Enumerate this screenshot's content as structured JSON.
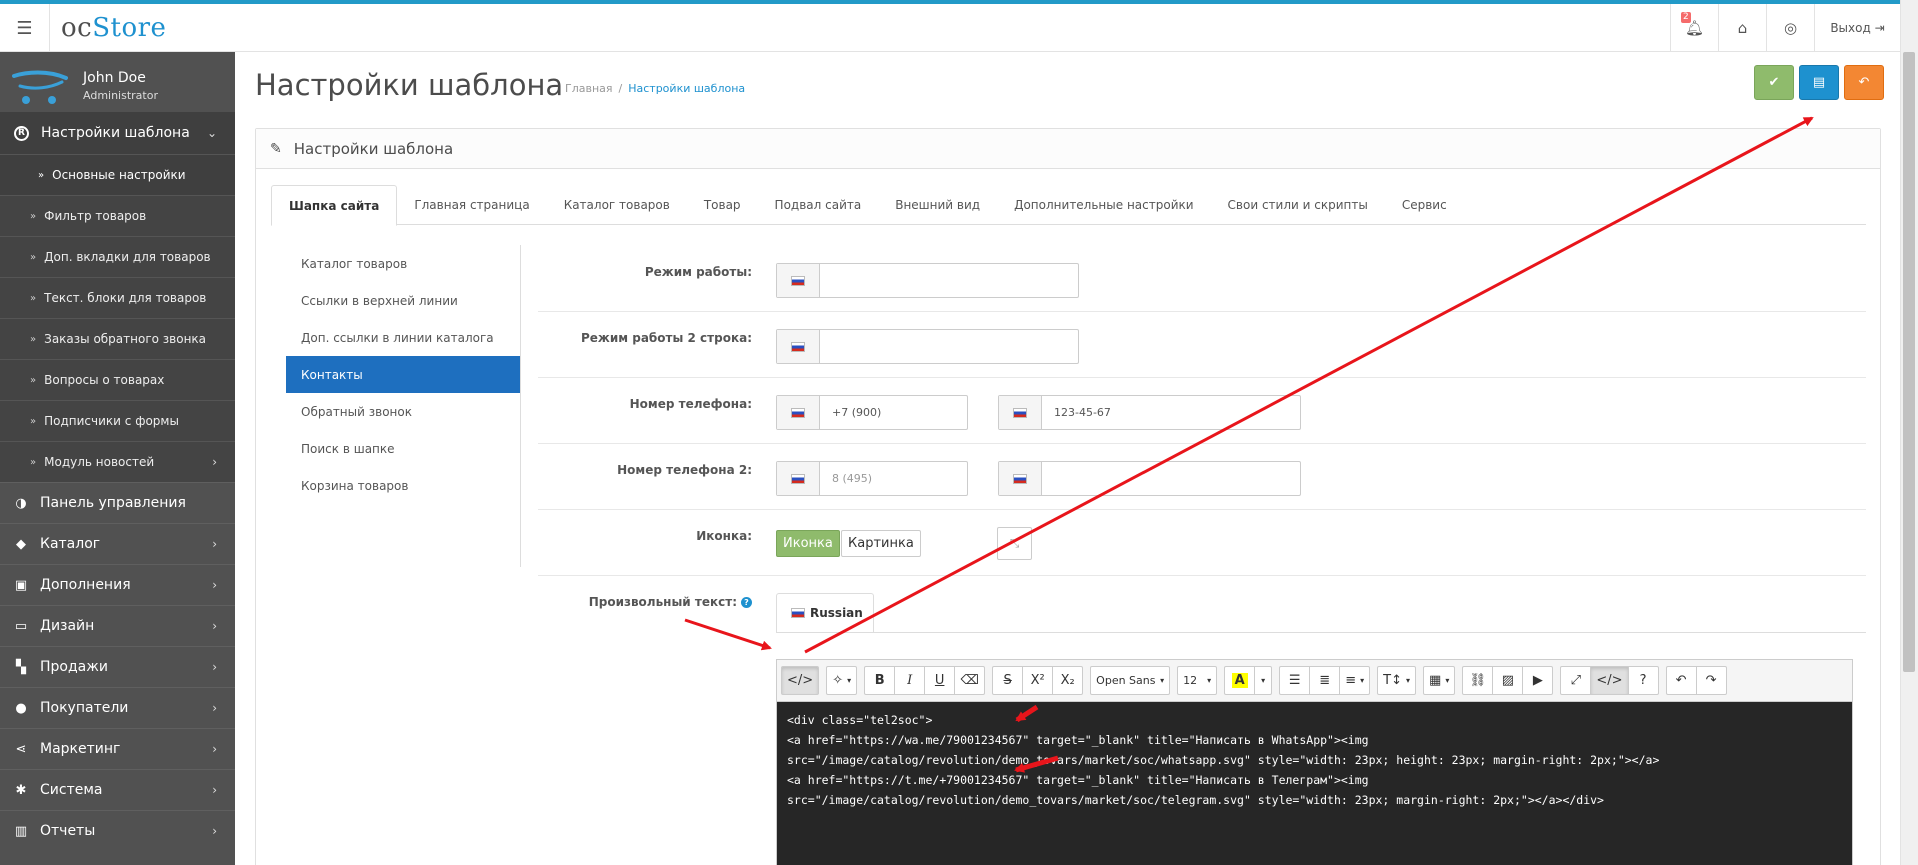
{
  "header": {
    "brand_oc": "oc",
    "brand_store": "Store",
    "notifications_count": "2",
    "logout_label": "Выход"
  },
  "sidebar": {
    "user_name": "John Doe",
    "user_role": "Administrator",
    "active_section": "Настройки шаблона",
    "active_sub": "Основные настройки",
    "sub_items": [
      "Фильтр товаров",
      "Доп. вкладки для товаров",
      "Текст. блоки для товаров",
      "Заказы обратного звонка",
      "Вопросы о товарах",
      "Подписчики с формы",
      "Модуль новостей"
    ],
    "main_items": [
      {
        "label": "Панель управления",
        "icon": "dashboard-icon"
      },
      {
        "label": "Каталог",
        "icon": "tag-icon"
      },
      {
        "label": "Дополнения",
        "icon": "puzzle-icon"
      },
      {
        "label": "Дизайн",
        "icon": "monitor-icon"
      },
      {
        "label": "Продажи",
        "icon": "cart-icon"
      },
      {
        "label": "Покупатели",
        "icon": "user-icon"
      },
      {
        "label": "Маркетинг",
        "icon": "share-icon"
      },
      {
        "label": "Система",
        "icon": "gear-icon"
      },
      {
        "label": "Отчеты",
        "icon": "bar-chart-icon"
      }
    ]
  },
  "page": {
    "title": "Настройки шаблона",
    "breadcrumb_home": "Главная",
    "breadcrumb_current": "Настройки шаблона",
    "panel_title": "Настройки шаблона"
  },
  "tabs": [
    "Шапка сайта",
    "Главная страница",
    "Каталог товаров",
    "Товар",
    "Подвал сайта",
    "Внешний вид",
    "Дополнительные настройки",
    "Свои стили и скрипты",
    "Сервис"
  ],
  "vnav": [
    "Каталог товаров",
    "Ссылки в верхней линии",
    "Доп. ссылки в линии каталога",
    "Контакты",
    "Обратный звонок",
    "Поиск в шапке",
    "Корзина товаров"
  ],
  "form": {
    "work_mode_label": "Режим работы:",
    "work_mode_value": "",
    "work_mode2_label": "Режим работы 2 строка:",
    "work_mode2_value": "",
    "phone_label": "Номер телефона:",
    "phone_code_value": "+7 (900)",
    "phone_number_value": "123-45-67",
    "phone2_label": "Номер телефона 2:",
    "phone2_code_placeholder": "8 (495)",
    "phone2_number_value": "",
    "icon_label": "Иконка:",
    "icon_toggle_on": "Иконка",
    "icon_toggle_off": "Картинка",
    "custom_text_label": "Произвольный текст:",
    "help_mark": "?",
    "lang_tab": "Russian"
  },
  "editor": {
    "font_name": "Open Sans",
    "font_size": "12",
    "code": "<div class=\"tel2soc\">\n<a href=\"https://wa.me/79001234567\" target=\"_blank\" title=\"Написать в WhatsApp\"><img\nsrc=\"/image/catalog/revolution/demo_tovars/market/soc/whatsapp.svg\" style=\"width: 23px; height: 23px; margin-right: 2px;\"></a>\n<a href=\"https://t.me/+79001234567\" target=\"_blank\" title=\"Написать в Телеграм\"><img\nsrc=\"/image/catalog/revolution/demo_tovars/market/soc/telegram.svg\" style=\"width: 23px; margin-right: 2px;\"></a></div>"
  },
  "colors": {
    "accent": "#1e91cf",
    "sidebar_bg": "#515151",
    "success": "#8fbb6c",
    "warning": "#f38733",
    "annotation": "#e8151b"
  }
}
